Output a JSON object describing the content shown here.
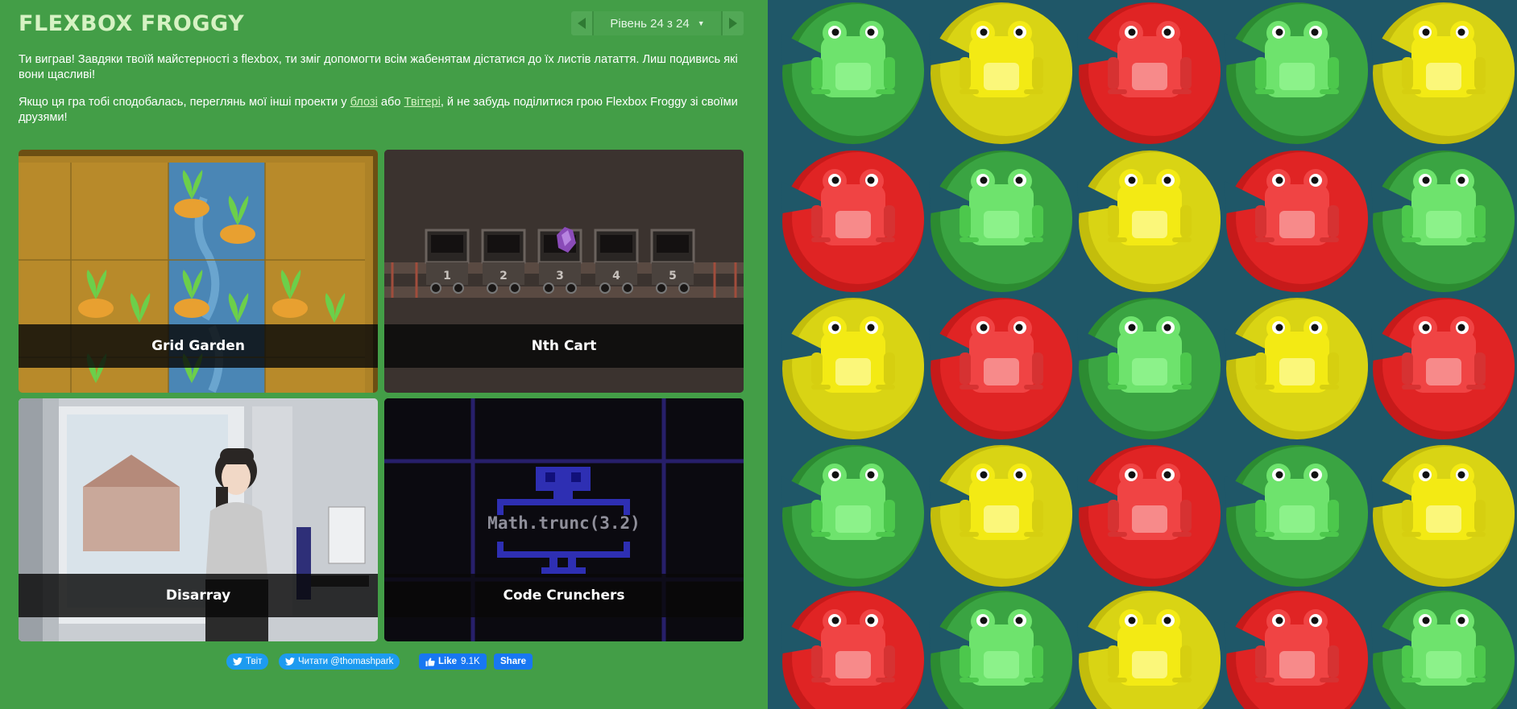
{
  "app": {
    "title": "FLEXBOX FROGGY"
  },
  "level_nav": {
    "indicator": "Рівень 24 з 24",
    "caret": "▼"
  },
  "intro": {
    "p1": "Ти виграв! Завдяки твоїй майстерності з flexbox, ти зміг допомогти всім жабенятам дістатися до їх листів латаття. Лиш подивись які вони щасливі!",
    "p2_before": "Якщо ця гра тобі сподобалась, переглянь мої інші проекти у ",
    "p2_link1": "блозі",
    "p2_mid": " або ",
    "p2_link2": "Твітері",
    "p2_after": ", й не забудь поділитися грою Flexbox Froggy зі своїми друзями!"
  },
  "cards": [
    {
      "name": "Grid Garden"
    },
    {
      "name": "Nth Cart",
      "cart_numbers": [
        "1",
        "2",
        "3",
        "4",
        "5"
      ]
    },
    {
      "name": "Disarray"
    },
    {
      "name": "Code Crunchers",
      "code_text": "Math.trunc(3.2)"
    }
  ],
  "social": {
    "tweet": "Твіт",
    "follow": "Читати @thomashpark",
    "like": "Like",
    "like_count": "9.1K",
    "share": "Share"
  },
  "pond": {
    "frog_colors": {
      "green": "#6ee36d",
      "yellow": "#f3ea14",
      "red": "#f04444"
    },
    "rows": [
      [
        "green",
        "yellow",
        "red",
        "green",
        "yellow"
      ],
      [
        "red",
        "green",
        "yellow",
        "red",
        "green"
      ],
      [
        "yellow",
        "red",
        "green",
        "yellow",
        "red"
      ],
      [
        "green",
        "yellow",
        "red",
        "green",
        "yellow"
      ],
      [
        "red",
        "green",
        "yellow",
        "red",
        "green"
      ]
    ]
  }
}
